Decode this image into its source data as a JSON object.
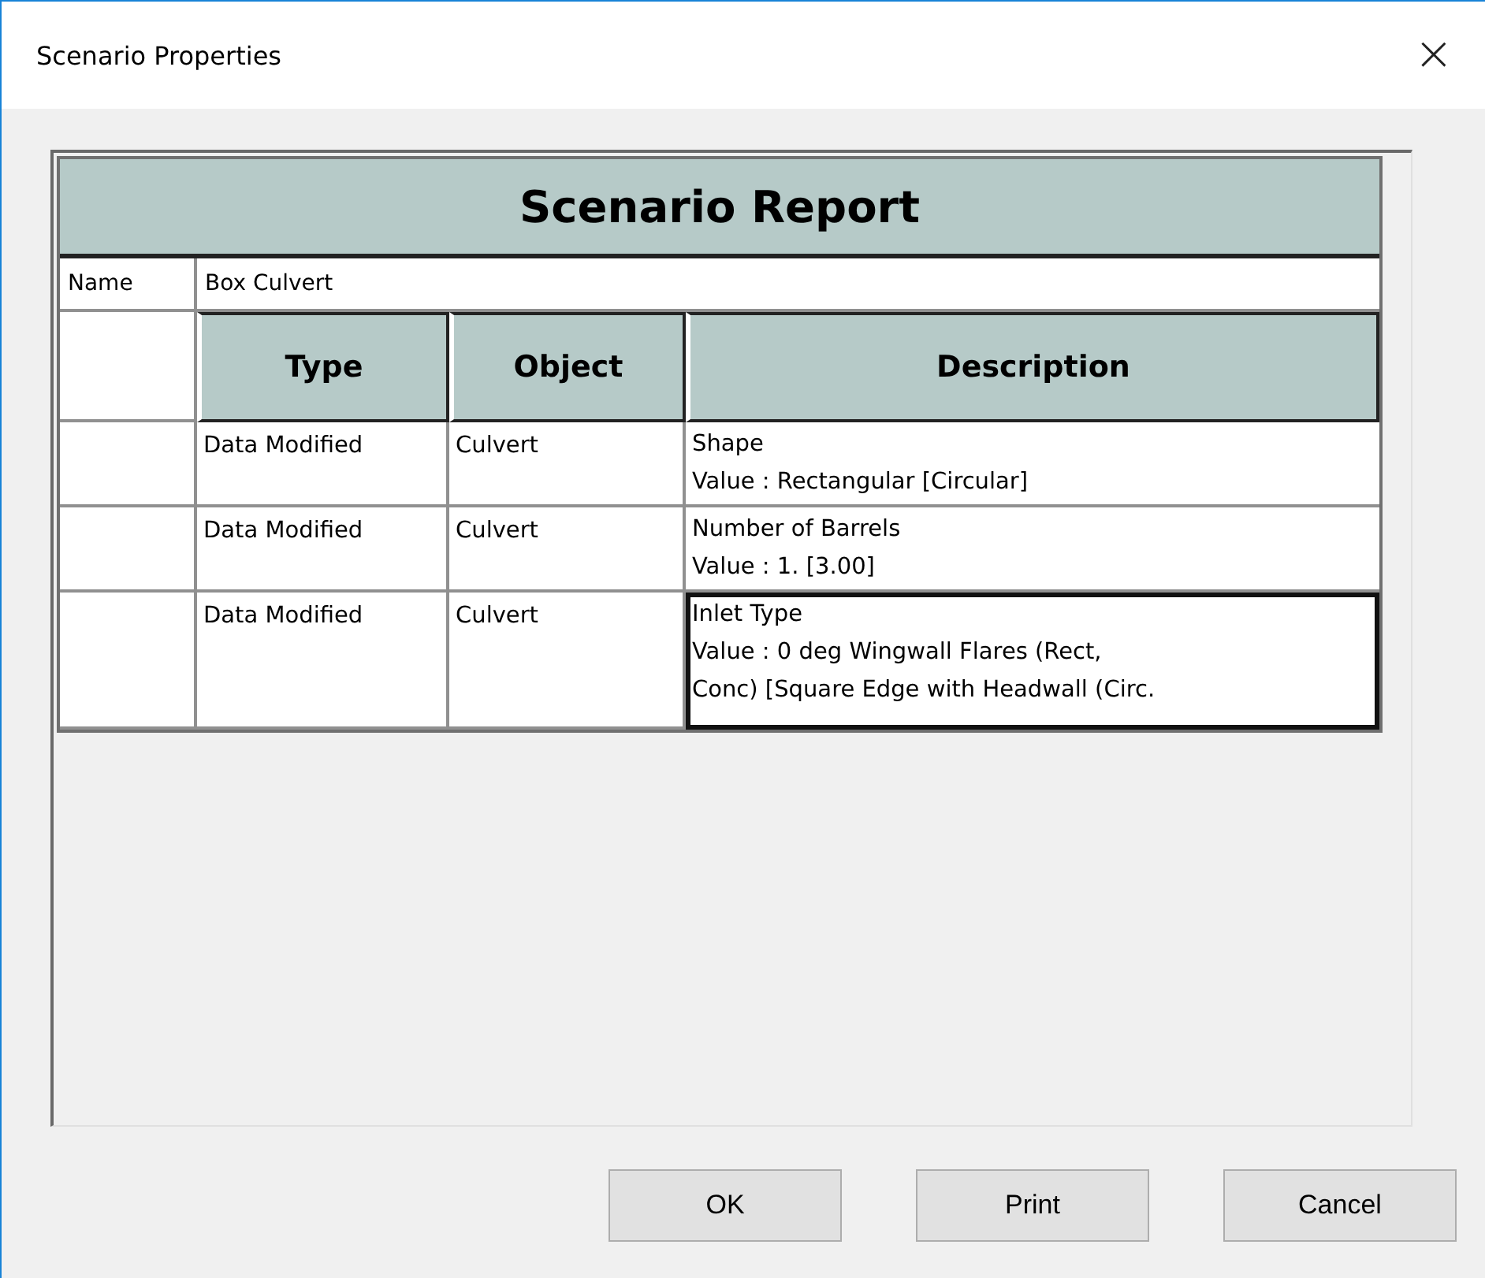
{
  "window": {
    "title": "Scenario Properties",
    "close": "×"
  },
  "report": {
    "title": "Scenario Report",
    "name_label": "Name",
    "name_value": "Box Culvert",
    "columns": [
      "Type",
      "Object",
      "Description"
    ],
    "rows": [
      {
        "type": "Data Modified",
        "object": "Culvert",
        "description": [
          "Shape",
          "Value : Rectangular [Circular]"
        ],
        "selected": false
      },
      {
        "type": "Data Modified",
        "object": "Culvert",
        "description": [
          "Number of Barrels",
          "Value : 1. [3.00]"
        ],
        "selected": false
      },
      {
        "type": "Data Modified",
        "object": "Culvert",
        "description": [
          "Inlet Type",
          "Value : 0 deg Wingwall Flares (Rect,",
          "Conc) [Square Edge with Headwall (Circ."
        ],
        "selected": true
      }
    ]
  },
  "buttons": [
    "OK",
    "Print",
    "Cancel"
  ]
}
